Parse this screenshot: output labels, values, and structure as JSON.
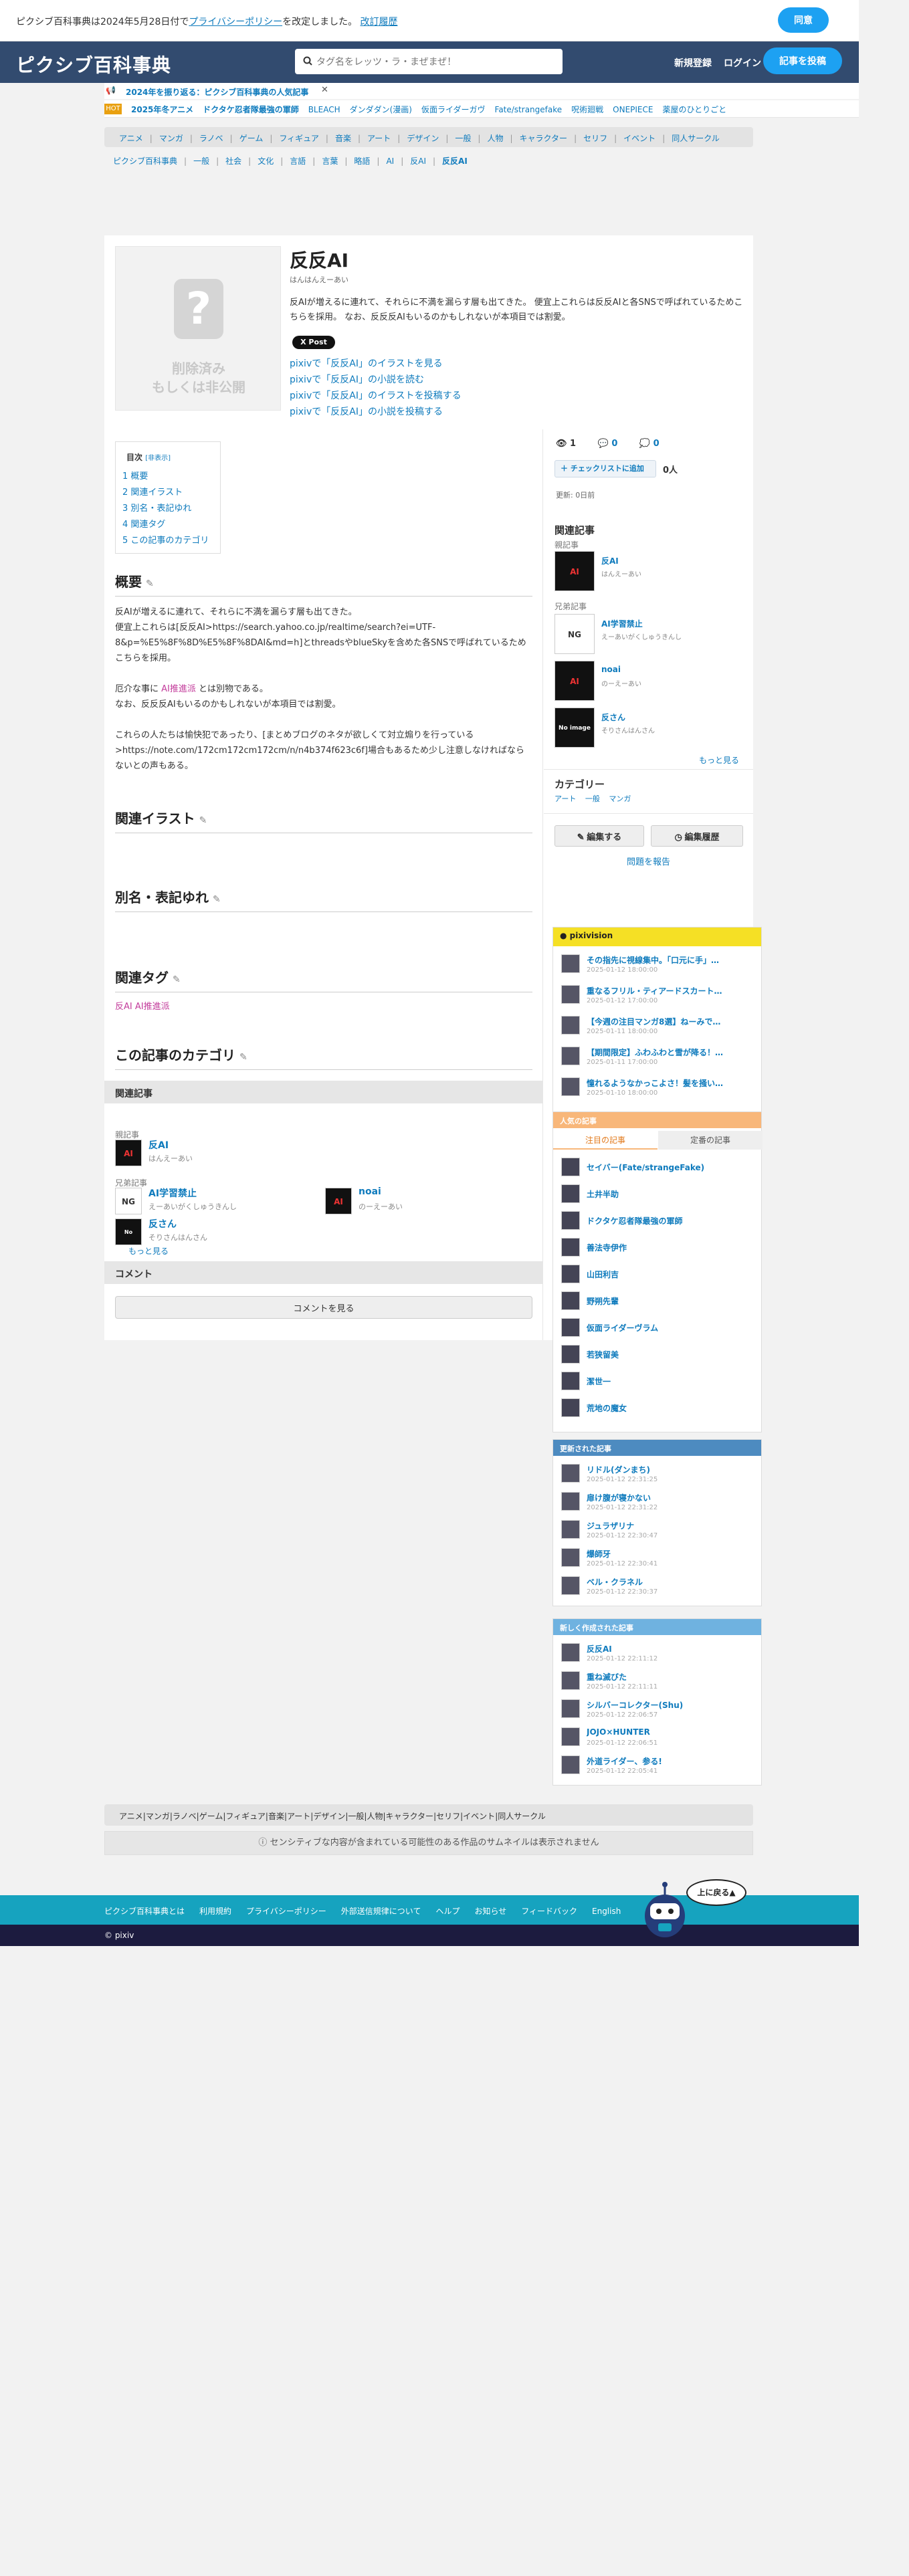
{
  "cookie": {
    "text_before": "ピクシブ百科事典は2024年5月28日付で",
    "policy_link": "プライバシーポリシー",
    "text_after": "を改定しました。",
    "history_link": "改訂履歴",
    "agree_label": "同意"
  },
  "header": {
    "logo": "ピクシブ百科事典",
    "search_placeholder": "タグ名をレッツ・ラ・まぜまぜ！",
    "signup": "新規登録",
    "login": "ログイン",
    "post_article": "記事を投稿"
  },
  "notice": {
    "text": "2024年を振り返る：ピクシブ百科事典の人気記事"
  },
  "trending": {
    "badge": "HOT",
    "items": [
      "2025年冬アニメ",
      "ドクタケ忍者隊最強の軍師",
      "BLEACH",
      "ダンダダン(漫画)",
      "仮面ライダーガヴ",
      "Fate/strangefake",
      "呪術廻戦",
      "ONEPIECE",
      "薬屋のひとりごと"
    ]
  },
  "categories": [
    "アニメ",
    "マンガ",
    "ラノベ",
    "ゲーム",
    "フィギュア",
    "音楽",
    "アート",
    "デザイン",
    "一般",
    "人物",
    "キャラクター",
    "セリフ",
    "イベント",
    "同人サークル"
  ],
  "breadcrumb": [
    "ピクシブ百科事典",
    "一般",
    "社会",
    "文化",
    "言語",
    "言葉",
    "略語",
    "AI",
    "反AI",
    "反反AI"
  ],
  "article": {
    "no_image_1": "削除済み",
    "no_image_2": "もしくは非公開",
    "title": "反反AI",
    "reading": "はんはんえーあい",
    "summary": "反AIが増えるに連れて、それらに不満を漏らす層も出てきた。 便宜上これらは反反AIと各SNSで呼ばれているためこちらを採用。 なお、反反反AIもいるのかもしれないが本項目では割愛。",
    "x_post": "X Post",
    "pixiv_links": [
      "pixivで「反反AI」のイラストを見る",
      "pixivで「反反AI」の小説を読む",
      "pixivで「反反AI」のイラストを投稿する",
      "pixivで「反反AI」の小説を投稿する"
    ]
  },
  "toc": {
    "title": "目次",
    "toggle": "[非表示]",
    "items": [
      "1 概要",
      "2 関連イラスト",
      "3 別名・表記ゆれ",
      "4 関連タグ",
      "5 この記事のカテゴリ"
    ]
  },
  "sections": {
    "overview": "概要",
    "illust": "関連イラスト",
    "alias": "別名・表記ゆれ",
    "tags": "関連タグ",
    "category": "この記事のカテゴリ"
  },
  "overview_text": {
    "p1": "反AIが増えるに連れて、それらに不満を漏らす層も出てきた。",
    "p2": "便宜上これらは[反反AI>https://search.yahoo.co.jp/realtime/search?ei=UTF-8&p=%E5%8F%8D%E5%8F%8DAI&md=h]とthreadsやblueSkyを含めた各SNSで呼ばれているためこちらを採用。",
    "p3_a": "厄介な事に",
    "p3_b": "AI推進派",
    "p3_c": "とは別物である。",
    "p4": "なお、反反反AIもいるのかもしれないが本項目では割愛。",
    "p5": "これらの人たちは愉快犯であったり、[まとめブログのネタが欲しくて対立煽りを行っている>https://note.com/172cm172cm172cm/n/n4b374f623c6f]場合もあるため少し注意しなければならないとの声もある。"
  },
  "related_tags": [
    "反AI",
    "AI推進派"
  ],
  "related": {
    "bar": "関連記事",
    "parent_label": "親記事",
    "sibling_label": "兄弟記事",
    "parent": {
      "name": "反AI",
      "reading": "はんえーあい",
      "thumb": "AI"
    },
    "siblings": [
      {
        "name": "AI学習禁止",
        "reading": "えーあいがくしゅうきんし",
        "thumb": "NG"
      },
      {
        "name": "noai",
        "reading": "のーえーあい",
        "thumb": "AI"
      },
      {
        "name": "反さん",
        "reading": "そりさんはんさん",
        "thumb": "No image"
      }
    ],
    "more": "もっと見る"
  },
  "comments": {
    "bar": "コメント",
    "button": "コメントを見る"
  },
  "sidebar": {
    "views": "1",
    "comments": "0",
    "likes": "0",
    "checklist": "チェックリストに追加",
    "check_count": "0人",
    "updated": "更新: 0日前",
    "related_title": "関連記事",
    "category_title": "カテゴリー",
    "category_items": [
      "アート",
      "一般",
      "マンガ"
    ],
    "edit": "編集する",
    "history": "編集履歴",
    "report": "問題を報告"
  },
  "pixivision": {
    "title": "pixivision",
    "items": [
      {
        "title": "その指先に視線集中。「口元に手」…",
        "date": "2025-01-12 18:00:00"
      },
      {
        "title": "重なるフリル・ティアードスカート…",
        "date": "2025-01-12 17:00:00"
      },
      {
        "title": "【今週の注目マンガ8選】ねーみで…",
        "date": "2025-01-11 18:00:00"
      },
      {
        "title": "【期間限定】ふわふわと雪が降る！…",
        "date": "2025-01-11 17:00:00"
      },
      {
        "title": "憧れるようなかっこよさ！髪を掻い…",
        "date": "2025-01-10 18:00:00"
      }
    ]
  },
  "popular": {
    "title": "人気の記事",
    "tab_active": "注目の記事",
    "tab_other": "定番の記事",
    "items": [
      "セイバー(Fate/strangeFake)",
      "土井半助",
      "ドクタケ忍者隊最強の軍師",
      "善法寺伊作",
      "山田利吉",
      "野朔先輩",
      "仮面ライダーヴラム",
      "若狭留美",
      "潔世一",
      "荒地の魔女"
    ]
  },
  "updated_articles": {
    "title": "更新された記事",
    "items": [
      {
        "title": "リドル(ダンまち)",
        "date": "2025-01-12 22:31:25"
      },
      {
        "title": "扉け腹が寝かない",
        "date": "2025-01-12 22:31:22"
      },
      {
        "title": "ジュラザリナ",
        "date": "2025-01-12 22:30:47"
      },
      {
        "title": "爆師牙",
        "date": "2025-01-12 22:30:41"
      },
      {
        "title": "ベル・クラネル",
        "date": "2025-01-12 22:30:37"
      }
    ]
  },
  "new_articles": {
    "title": "新しく作成された記事",
    "items": [
      {
        "title": "反反AI",
        "date": "2025-01-12 22:11:12"
      },
      {
        "title": "重ね滅びた",
        "date": "2025-01-12 22:11:11"
      },
      {
        "title": "シルバーコレクター(Shu)",
        "date": "2025-01-12 22:06:57"
      },
      {
        "title": "JOJO×HUNTER",
        "date": "2025-01-12 22:06:51"
      },
      {
        "title": "外道ライダー、参る!",
        "date": "2025-01-12 22:05:41"
      }
    ]
  },
  "sensitive": "センシティブな内容が含まれている可能性のある作品のサムネイルは表示されません",
  "footer": {
    "links": [
      "ピクシブ百科事典とは",
      "利用規約",
      "プライバシーポリシー",
      "外部送信規律について",
      "ヘルプ",
      "お知らせ",
      "フィードバック",
      "English"
    ],
    "copyright": "© pixiv",
    "to_top": "上に戻る▲"
  },
  "colors": {
    "header": "#324b6f",
    "accent": "#1da1f2",
    "link": "#0f7bbd",
    "footer": "#16a3bf"
  }
}
